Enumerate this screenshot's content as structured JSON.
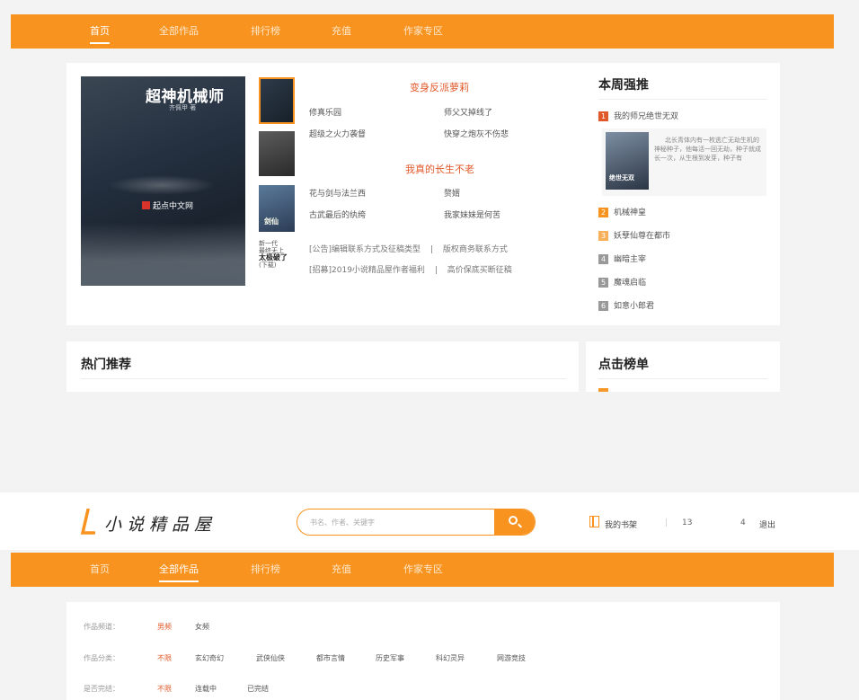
{
  "nav": {
    "items": [
      "首页",
      "全部作品",
      "排行榜",
      "充值",
      "作家专区"
    ]
  },
  "featured": {
    "cover_title": "超神机械师",
    "cover_author": "齐佩甲 著",
    "cover_brand": "起点中文网",
    "thumb3_label": "剑仙",
    "thumb4_lines": [
      "新一代",
      "最终无上",
      "太极破了",
      "(下载)"
    ],
    "block1_title": "变身反派萝莉",
    "block1_links": [
      "修真乐园",
      "师父又掉线了",
      "超级之火力袭督",
      "快穿之炮灰不伤悲"
    ],
    "block2_title": "我真的长生不老",
    "block2_links": [
      "花与剑与法兰西",
      "赘婿",
      "古武最后的纨绔",
      "我家妹妹是何苦"
    ],
    "notices": [
      [
        "[公告]编辑联系方式及征稿类型",
        "|",
        "版权商务联系方式"
      ],
      [
        "[招募]2019小说精品屋作者福利",
        "|",
        "高价保底买断征稿"
      ]
    ]
  },
  "weekly": {
    "title": "本周强推",
    "items": [
      {
        "num": "1",
        "name": "我的师兄绝世无双",
        "color": "#e0592a"
      },
      {
        "num": "2",
        "name": "机械神皇",
        "color": "#f7931e"
      },
      {
        "num": "3",
        "name": "妖孽仙尊在都市",
        "color": "#f7b05a"
      },
      {
        "num": "4",
        "name": "幽暗主宰",
        "color": "#999999"
      },
      {
        "num": "5",
        "name": "魔魂启临",
        "color": "#999999"
      },
      {
        "num": "6",
        "name": "如意小郎君",
        "color": "#999999"
      }
    ],
    "feature_desc": "北长青体内有一枚逃亡无劫生机的神秘种子，他每活一回无劫，种子就成长一次，从生根到发芽，种子有",
    "feature_cover": "绝世无双"
  },
  "hot": {
    "title": "热门推荐"
  },
  "click_rank": {
    "title": "点击榜单"
  },
  "header": {
    "logo_text": "小说精品屋",
    "search_placeholder": "书名、作者、关键字",
    "shelf_label": "我的书架",
    "separator": "|",
    "phone": "13",
    "phone_tail": "4",
    "logout": "退出"
  },
  "filters": [
    {
      "label": "作品频道：",
      "options": [
        "男频",
        "女频"
      ],
      "selected": 0
    },
    {
      "label": "作品分类：",
      "options": [
        "不限",
        "玄幻奇幻",
        "武侠仙侠",
        "都市言情",
        "历史军事",
        "科幻灵异",
        "网游竞技"
      ],
      "selected": 0
    },
    {
      "label": "是否完结：",
      "options": [
        "不限",
        "连载中",
        "已完结"
      ],
      "selected": 0
    }
  ],
  "colors": {
    "accent": "#f7931e",
    "highlight": "#e0592a"
  }
}
